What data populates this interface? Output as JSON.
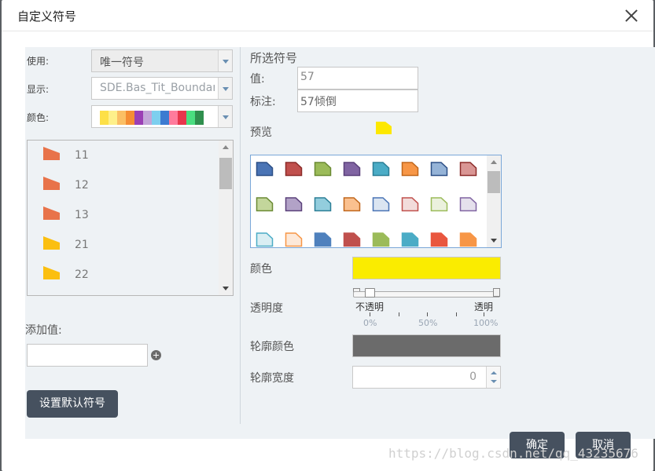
{
  "dialog": {
    "title": "自定义符号",
    "ok_label": "确定",
    "cancel_label": "取消"
  },
  "left": {
    "use_label": "使用:",
    "use_value": "唯一符号",
    "display_label": "显示:",
    "display_value": "SDE.Bas_Tit_Boundary",
    "color_label": "颜色:",
    "palette": [
      "#fde047",
      "#fef08a",
      "#fbbf64",
      "#f58d33",
      "#9b3fb5",
      "#c3a5d8",
      "#7dcfef",
      "#3d7bd1",
      "#ff7b9c",
      "#e8364c",
      "#4ade80",
      "#2f8f4e"
    ],
    "list_items": [
      {
        "label": "11",
        "color": "#e8734a"
      },
      {
        "label": "12",
        "color": "#e8734a"
      },
      {
        "label": "13",
        "color": "#e8734a"
      },
      {
        "label": "21",
        "color": "#fbbf10"
      },
      {
        "label": "22",
        "color": "#fbbf10"
      },
      {
        "label": "",
        "color": "#fbbf10"
      }
    ],
    "add_value_label": "添加值:",
    "add_value_input": "",
    "set_default_label": "设置默认符号"
  },
  "right": {
    "selected_symbol_label": "所选符号",
    "value_label": "值:",
    "value": "57",
    "annotation_label": "标注:",
    "annotation": "57倾倒",
    "preview_label": "预览",
    "preview_color": "#fde800",
    "gallery_rows": [
      [
        {
          "fill": "#4a74b5",
          "stroke": "#2c4f86"
        },
        {
          "fill": "#c0504d",
          "stroke": "#8b2b29"
        },
        {
          "fill": "#9bbb59",
          "stroke": "#6a8a33"
        },
        {
          "fill": "#8064a2",
          "stroke": "#5a407a"
        },
        {
          "fill": "#4bacc6",
          "stroke": "#2b7e96"
        },
        {
          "fill": "#f79646",
          "stroke": "#c0661b"
        },
        {
          "fill": "#95b3d7",
          "stroke": "#2c4f86"
        },
        {
          "fill": "#d99694",
          "stroke": "#8b2b29"
        }
      ],
      [
        {
          "fill": "#c3d69b",
          "stroke": "#6a8a33"
        },
        {
          "fill": "#b2a2c7",
          "stroke": "#5a407a"
        },
        {
          "fill": "#93cddd",
          "stroke": "#2b7e96"
        },
        {
          "fill": "#fac08f",
          "stroke": "#c0661b"
        },
        {
          "fill": "#dbe5f1",
          "stroke": "#4a74b5"
        },
        {
          "fill": "#f2dcdb",
          "stroke": "#c0504d"
        },
        {
          "fill": "#ebf1dd",
          "stroke": "#9bbb59"
        },
        {
          "fill": "#e5e0ec",
          "stroke": "#8064a2"
        }
      ],
      [
        {
          "fill": "#daeef3",
          "stroke": "#4bacc6"
        },
        {
          "fill": "#fde9d9",
          "stroke": "#f79646"
        },
        {
          "fill": "#4f81bd",
          "stroke": "#4f81bd"
        },
        {
          "fill": "#c0504d",
          "stroke": "#c0504d"
        },
        {
          "fill": "#9bbb59",
          "stroke": "#9bbb59"
        },
        {
          "fill": "#4bacc6",
          "stroke": "#4bacc6"
        },
        {
          "fill": "#e9573f",
          "stroke": "#e9573f"
        },
        {
          "fill": "#f79646",
          "stroke": "#f79646"
        }
      ]
    ],
    "color_label": "颜色",
    "fill_color": "#faec00",
    "opacity_label": "透明度",
    "opaque_label": "不透明",
    "transparent_label": "透明",
    "pct_0": "0%",
    "pct_50": "50%",
    "pct_100": "100%",
    "opacity_value": 0,
    "outline_color_label": "轮廓颜色",
    "outline_color": "#6b6b6b",
    "outline_width_label": "轮廓宽度",
    "outline_width": "0"
  },
  "watermark": "https://blog.csdn.net/qq_43235676"
}
